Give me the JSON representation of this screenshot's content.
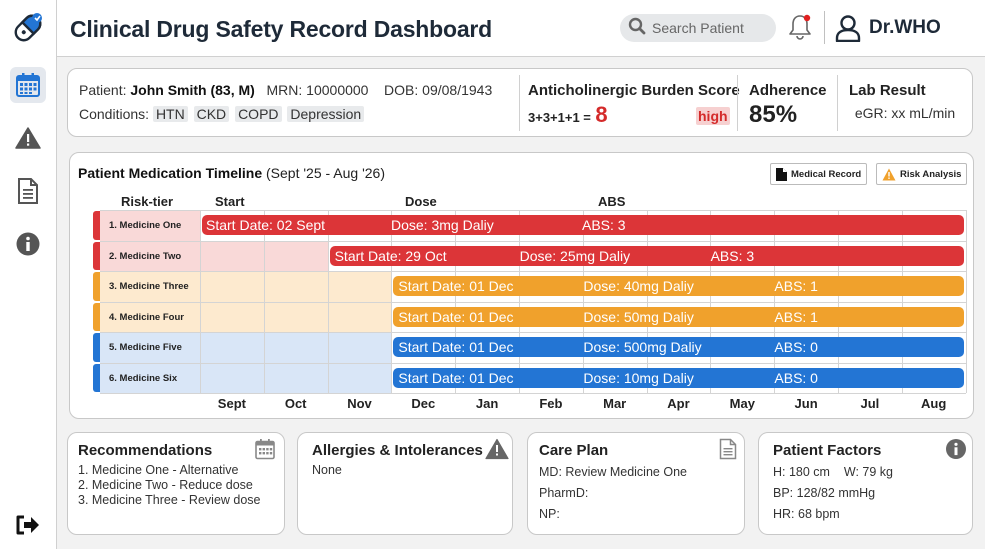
{
  "app": {
    "title": "Clinical Drug Safety Record Dashboard",
    "logo_icon": "capsule-icon"
  },
  "search": {
    "placeholder": "Search Patient"
  },
  "user": {
    "name": "Dr.WHO"
  },
  "colors": {
    "red": "#dc3538",
    "orange": "#f0a12c",
    "blue": "#2375d4",
    "text_dark": "#1e2a38",
    "high_badge": "#f6d0d0"
  },
  "sidebar": {
    "items": [
      {
        "icon": "calendar-icon",
        "active": true
      },
      {
        "icon": "warning-icon",
        "active": false
      },
      {
        "icon": "document-icon",
        "active": false
      },
      {
        "icon": "info-icon",
        "active": false
      }
    ],
    "logout_icon": "logout-icon"
  },
  "patient": {
    "label": "Patient:",
    "name": "John Smith (83, M)",
    "mrn_label": "MRN:",
    "mrn": "10000000",
    "dob_label": "DOB:",
    "dob": "09/08/1943",
    "conditions_label": "Conditions:",
    "conditions": [
      "HTN",
      "CKD",
      "COPD",
      "Depression"
    ]
  },
  "acb": {
    "title": "Anticholinergic Burden Score",
    "formula": "3+3+1+1 =",
    "total": "8",
    "level": "high"
  },
  "adherence": {
    "title": "Adherence",
    "value": "85%"
  },
  "lab": {
    "title": "Lab Result",
    "value": "eGR: xx mL/min"
  },
  "timeline": {
    "title": "Patient Medication Timeline",
    "range": "(Sept '25 - Aug '26)",
    "buttons": {
      "medical_record": "Medical Record",
      "risk_analysis": "Risk Analysis"
    },
    "column_headers": {
      "risk_tier": "Risk-tier",
      "start": "Start",
      "dose": "Dose",
      "abs": "ABS"
    },
    "months": [
      "Sept",
      "Oct",
      "Nov",
      "Dec",
      "Jan",
      "Feb",
      "Mar",
      "Apr",
      "May",
      "Jun",
      "Jul",
      "Aug"
    ],
    "medications": [
      {
        "label": "1. Medicine One",
        "tier": "red",
        "start_month_index": 0,
        "start": "Start Date: 02 Sept",
        "dose": "Dose: 3mg Daliy",
        "abs": "ABS: 3"
      },
      {
        "label": "2. Medicine Two",
        "tier": "red",
        "start_month_index": 2,
        "start": "Start Date: 29 Oct",
        "dose": "Dose: 25mg Daliy",
        "abs": "ABS: 3"
      },
      {
        "label": "3. Medicine Three",
        "tier": "orange",
        "start_month_index": 3,
        "start": "Start Date: 01 Dec",
        "dose": "Dose: 40mg Daliy",
        "abs": "ABS: 1"
      },
      {
        "label": "4. Medicine Four",
        "tier": "orange",
        "start_month_index": 3,
        "start": "Start Date: 01 Dec",
        "dose": "Dose: 50mg Daliy",
        "abs": "ABS: 1"
      },
      {
        "label": "5. Medicine Five",
        "tier": "blue",
        "start_month_index": 3,
        "start": "Start Date: 01 Dec",
        "dose": "Dose: 500mg Daliy",
        "abs": "ABS: 0"
      },
      {
        "label": "6. Medicine Six",
        "tier": "blue",
        "start_month_index": 3,
        "start": "Start Date: 01 Dec",
        "dose": "Dose: 10mg Daliy",
        "abs": "ABS: 0"
      }
    ]
  },
  "recommendations": {
    "title": "Recommendations",
    "items": [
      "1. Medicine One - Alternative",
      "2. Medicine Two - Reduce dose",
      "3. Medicine Three - Review dose"
    ]
  },
  "allergies": {
    "title": "Allergies & Intolerances",
    "value": "None"
  },
  "care_plan": {
    "title": "Care Plan",
    "md": "MD: Review Medicine One",
    "pharmd": "PharmD:",
    "np": "NP:"
  },
  "patient_factors": {
    "title": "Patient Factors",
    "height": "H: 180 cm",
    "weight": "W: 79 kg",
    "bp": "BP: 128/82 mmHg",
    "hr": "HR: 68 bpm"
  }
}
